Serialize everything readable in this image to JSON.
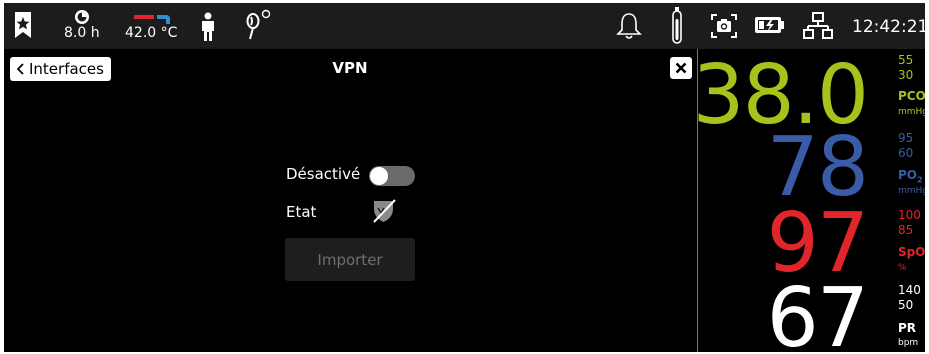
{
  "topbar": {
    "timer_value": "8.0 h",
    "temp_value": "42.0 °C",
    "clock": "12:42:21",
    "icons": [
      "bookmark-star-icon",
      "timer-icon",
      "temperature-bar-icon",
      "patient-icon",
      "sensor-icon",
      "bell-icon",
      "gas-cylinder-icon",
      "camera-icon",
      "battery-charging-icon",
      "network-icon"
    ]
  },
  "main": {
    "back_label": "Interfaces",
    "title": "VPN",
    "toggle_label": "Désactivé",
    "toggle_on": false,
    "state_label": "Etat",
    "import_label": "Importer"
  },
  "vitals": [
    {
      "value": "38.0",
      "high": "55",
      "low": "30",
      "name": "PCO",
      "sub": "2",
      "unit": "mmHg",
      "color": "#a8c21c"
    },
    {
      "value": "78",
      "high": "95",
      "low": "60",
      "name": "PO",
      "sub": "2",
      "unit": "mmHg",
      "color": "#3a5ba8"
    },
    {
      "value": "97",
      "high": "100",
      "low": "85",
      "name": "SpO",
      "sub": "2",
      "unit": "%",
      "color": "#e0262a"
    },
    {
      "value": "67",
      "high": "140",
      "low": "50",
      "name": "PR",
      "sub": "",
      "unit": "bpm",
      "color": "#ffffff"
    }
  ],
  "colors": {
    "temp_red": "#e0262a",
    "temp_blue": "#2f8fd6"
  }
}
